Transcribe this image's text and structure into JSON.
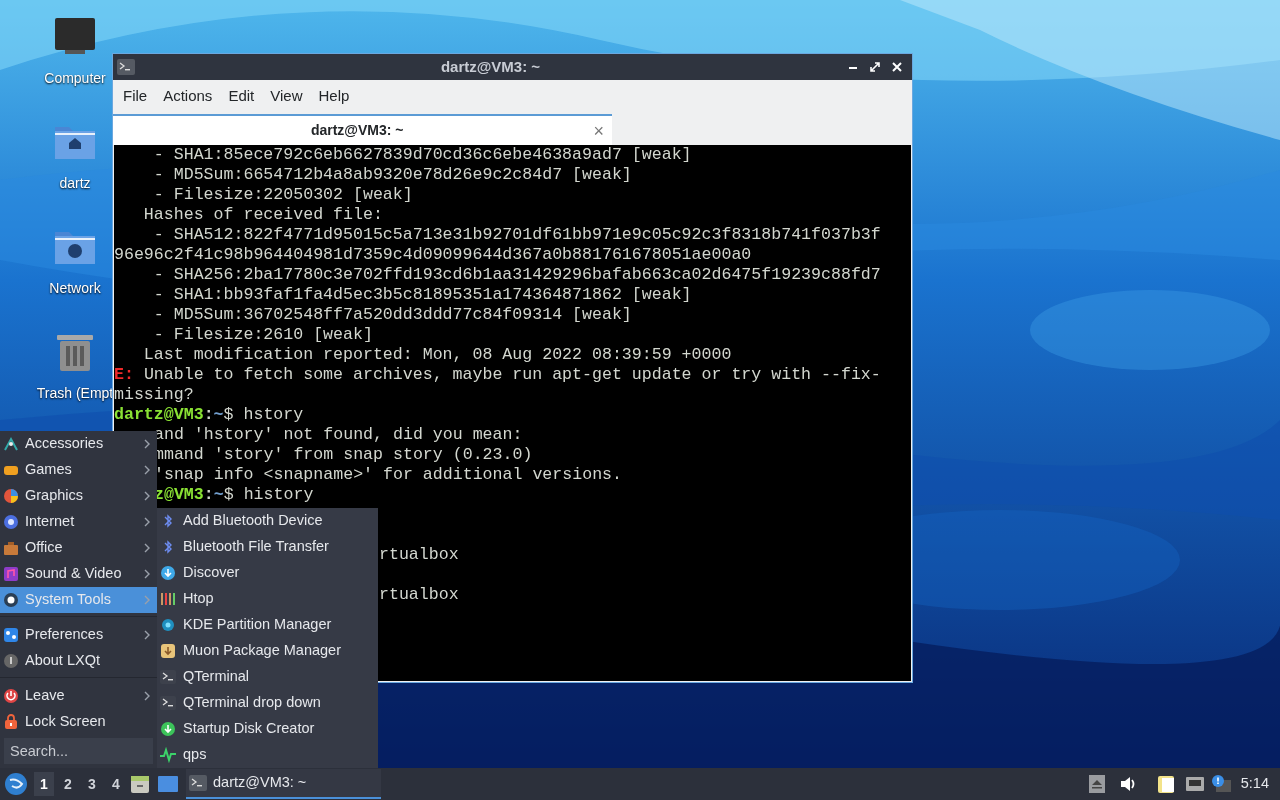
{
  "desktop_icons": [
    {
      "label": "Computer",
      "kind": "computer"
    },
    {
      "label": "dartz",
      "kind": "home"
    },
    {
      "label": "Network",
      "kind": "network"
    },
    {
      "label": "Trash (Empt",
      "kind": "trash"
    }
  ],
  "terminal_window": {
    "title": "dartz@VM3: ~",
    "menu": [
      "File",
      "Actions",
      "Edit",
      "View",
      "Help"
    ],
    "tabs": [
      {
        "label": "dartz@VM3: ~",
        "selected": true,
        "close": "×"
      }
    ],
    "lines": [
      {
        "kind": "plain",
        "text": "    - SHA1:85ece792c6eb6627839d70cd36c6ebe4638a9ad7 [weak]"
      },
      {
        "kind": "plain",
        "text": "    - MD5Sum:6654712b4a8ab9320e78d26e9c2c84d7 [weak]"
      },
      {
        "kind": "plain",
        "text": "    - Filesize:22050302 [weak]"
      },
      {
        "kind": "plain",
        "text": "   Hashes of received file:"
      },
      {
        "kind": "plain",
        "text": "    - SHA512:822f4771d95015c5a713e31b92701df61bb971e9c05c92c3f8318b741f037b3f"
      },
      {
        "kind": "plain",
        "text": "96e96c2f41c98b964404981d7359c4d09099644d367a0b881761678051ae00a0"
      },
      {
        "kind": "plain",
        "text": "    - SHA256:2ba17780c3e702ffd193cd6b1aa31429296bafab663ca02d6475f19239c88fd7"
      },
      {
        "kind": "plain",
        "text": "    - SHA1:bb93faf1fa4d5ec3b5c81895351a174364871862 [weak]"
      },
      {
        "kind": "plain",
        "text": "    - MD5Sum:36702548ff7a520dd3ddd77c84f09314 [weak]"
      },
      {
        "kind": "plain",
        "text": "    - Filesize:2610 [weak]"
      },
      {
        "kind": "plain",
        "text": "   Last modification reported: Mon, 08 Aug 2022 08:39:59 +0000"
      },
      {
        "kind": "error",
        "tag": "E:",
        "text": " Unable to fetch some archives, maybe run apt-get update or try with --fix-"
      },
      {
        "kind": "plain",
        "text": "missing?"
      },
      {
        "kind": "prompt",
        "user": "dartz@VM3",
        "sep": ":",
        "path": "~",
        "command": "$ hstory"
      },
      {
        "kind": "plain_under_menu",
        "text": "and 'hstory' not found, did you mean:"
      },
      {
        "kind": "plain_under_menu",
        "text": "mmand 'story' from snap story (0.23.0)"
      },
      {
        "kind": "plain_under_menu",
        "text": "'snap info <snapname>' for additional versions."
      },
      {
        "kind": "prompt_under_menu",
        "user": "z@VM3",
        "sep": ":",
        "path": "~",
        "command": "$ history"
      },
      {
        "kind": "blank"
      },
      {
        "kind": "blank"
      },
      {
        "kind": "plain_under_submenu",
        "text": "rtualbox"
      },
      {
        "kind": "blank"
      },
      {
        "kind": "plain_under_submenu",
        "text": "rtualbox"
      }
    ]
  },
  "app_menu": {
    "items": [
      {
        "kind": "item",
        "label": "Accessories",
        "submenu": true,
        "selected": false
      },
      {
        "kind": "item",
        "label": "Games",
        "submenu": true,
        "selected": false
      },
      {
        "kind": "item",
        "label": "Graphics",
        "submenu": true,
        "selected": false
      },
      {
        "kind": "item",
        "label": "Internet",
        "submenu": true,
        "selected": false
      },
      {
        "kind": "item",
        "label": "Office",
        "submenu": true,
        "selected": false
      },
      {
        "kind": "item",
        "label": "Sound & Video",
        "submenu": true,
        "selected": false
      },
      {
        "kind": "item",
        "label": "System Tools",
        "submenu": true,
        "selected": true
      },
      {
        "kind": "separator"
      },
      {
        "kind": "item",
        "label": "Preferences",
        "submenu": true,
        "selected": false
      },
      {
        "kind": "item",
        "label": "About LXQt",
        "submenu": false,
        "selected": false
      },
      {
        "kind": "separator"
      },
      {
        "kind": "item",
        "label": "Leave",
        "submenu": true,
        "selected": false
      },
      {
        "kind": "item",
        "label": "Lock Screen",
        "submenu": false,
        "selected": false
      }
    ],
    "search": {
      "placeholder": "Search..."
    }
  },
  "submenu": {
    "items": [
      "Add Bluetooth Device",
      "Bluetooth File Transfer",
      "Discover",
      "Htop",
      "KDE Partition Manager",
      "Muon Package Manager",
      "QTerminal",
      "QTerminal drop down",
      "Startup Disk Creator",
      "qps"
    ]
  },
  "taskbar": {
    "desktops": [
      {
        "label": "1",
        "selected": true
      },
      {
        "label": "2",
        "selected": false
      },
      {
        "label": "3",
        "selected": false
      },
      {
        "label": "4",
        "selected": false
      }
    ],
    "tasks": [
      {
        "label": "dartz@VM3: ~",
        "selected": true
      }
    ],
    "clock": "5:14"
  }
}
